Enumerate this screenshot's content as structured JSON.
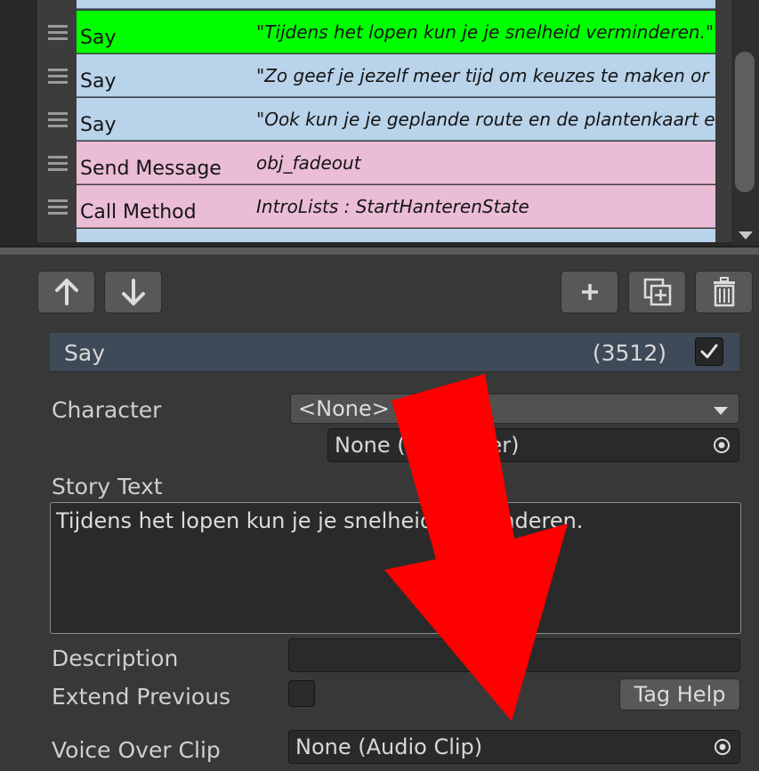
{
  "command_list": {
    "rows": [
      {
        "name": "Say",
        "summary": "\"Tijdens het lopen kun je je snelheid verminderen.\"",
        "style": "say-green"
      },
      {
        "name": "Say",
        "summary": "\"Zo geef je jezelf meer tijd om keuzes te maken or",
        "style": "say-blue"
      },
      {
        "name": "Say",
        "summary": "\"Ook kun je je geplande route en de plantenkaart e",
        "style": "say-blue"
      },
      {
        "name": "Send Message",
        "summary": "obj_fadeout",
        "style": "pink"
      },
      {
        "name": "Call Method",
        "summary": "IntroLists : StartHanterenState",
        "style": "pink"
      }
    ]
  },
  "toolbar": {
    "move_up_icon": "arrow-up-icon",
    "move_down_icon": "arrow-down-icon",
    "add_icon": "plus-icon",
    "duplicate_icon": "duplicate-icon",
    "delete_icon": "trash-icon"
  },
  "inspector": {
    "command_title": "Say",
    "command_index": "(3512)",
    "enabled": true,
    "character_label": "Character",
    "character_value": "<None>",
    "character_object_value": "None (Character)",
    "story_text_label": "Story Text",
    "story_text_value": "Tijdens het lopen kun je je snelheid verminderen.",
    "description_label": "Description",
    "description_value": "",
    "extend_previous_label": "Extend Previous",
    "tag_help_label": "Tag Help",
    "voice_over_label": "Voice Over Clip",
    "voice_over_value": "None (Audio Clip)"
  },
  "colors": {
    "row_highlight": "#00ff00",
    "say_row": "#b9d3ea",
    "message_row": "#ebbcd6",
    "arrow": "#ff0000"
  }
}
